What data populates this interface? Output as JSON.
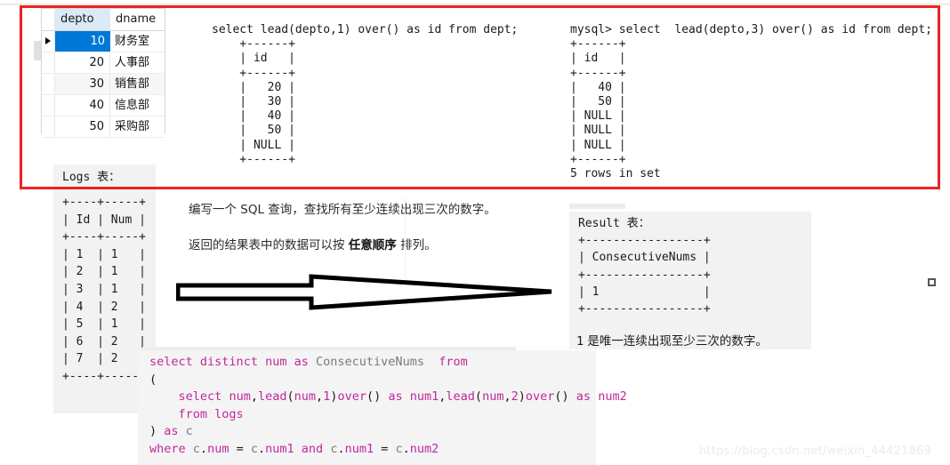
{
  "page": {
    "watermark": "https://blog.csdn.net/weixin_44421869",
    "accent_red": "#ee2222",
    "selection_blue": "#0078d7",
    "keyword_magenta": "#c0289a"
  },
  "dept_grid": {
    "name": "dept-table",
    "columns": [
      "depto",
      "dname"
    ],
    "rows": [
      {
        "depto": "10",
        "dname": "财务室",
        "selected": true
      },
      {
        "depto": "20",
        "dname": "人事部",
        "selected": false
      },
      {
        "depto": "30",
        "dname": "销售部",
        "selected": false
      },
      {
        "depto": "40",
        "dname": "信息部",
        "selected": false
      },
      {
        "depto": "50",
        "dname": "采购部",
        "selected": false
      }
    ]
  },
  "lead1": {
    "query": "select lead(depto,1) over() as id from dept;",
    "result_block": "    +------+\n    | id   |\n    +------+\n    |   20 |\n    |   30 |\n    |   40 |\n    |   50 |\n    | NULL |\n    +------+",
    "result_column": "id",
    "result_values": [
      "20",
      "30",
      "40",
      "50",
      "NULL"
    ]
  },
  "lead3": {
    "prompt": "mysql>",
    "query": "mysql> select  lead(depto,3) over() as id from dept;",
    "result_block": "+------+\n| id   |\n+------+\n|   40 |\n|   50 |\n| NULL |\n| NULL |\n| NULL |\n+------+\n5 rows in set",
    "result_column": "id",
    "result_values": [
      "40",
      "50",
      "NULL",
      "NULL",
      "NULL"
    ],
    "footer": "5 rows in set"
  },
  "logs": {
    "title": "Logs 表：",
    "columns": [
      "Id",
      "Num"
    ],
    "rows": [
      {
        "Id": "1",
        "Num": "1"
      },
      {
        "Id": "2",
        "Num": "1"
      },
      {
        "Id": "3",
        "Num": "1"
      },
      {
        "Id": "4",
        "Num": "2"
      },
      {
        "Id": "5",
        "Num": "1"
      },
      {
        "Id": "6",
        "Num": "2"
      },
      {
        "Id": "7",
        "Num": "2"
      }
    ],
    "ascii": "+----+-----+\n| Id | Num |\n+----+-----+\n| 1  | 1   |\n| 2  | 1   |\n| 3  | 1   |\n| 4  | 2   |\n| 5  | 1   |\n| 6  | 2   |\n| 7  | 2   |\n+----+-----+"
  },
  "prose": {
    "line1": "编写一个 SQL 查询，查找所有至少连续出现三次的数字。",
    "line2_before": "返回的结果表中的数据可以按 ",
    "line2_bold": "任意顺序",
    "line2_after": " 排列。"
  },
  "result": {
    "title": "Result 表：",
    "columns": [
      "ConsecutiveNums"
    ],
    "rows": [
      [
        "1"
      ]
    ],
    "ascii": "+-----------------+\n| ConsecutiveNums |\n+-----------------+\n| 1               |\n+-----------------+",
    "note_number": "1",
    "note_text": " 是唯一连续出现至少三次的数字。"
  },
  "sql_code": {
    "lines": [
      "select distinct num as ConsecutiveNums  from",
      "(",
      "    select num,lead(num,1)over() as num1,lead(num,2)over() as num2",
      "    from logs",
      ") as c",
      "where c.num = c.num1 and c.num1 = c.num2"
    ],
    "full": "select distinct num as ConsecutiveNums  from\n(\n    select num,lead(num,1)over() as num1,lead(num,2)over() as num2\n    from logs\n) as c\nwhere c.num = c.num1 and c.num1 = c.num2"
  }
}
